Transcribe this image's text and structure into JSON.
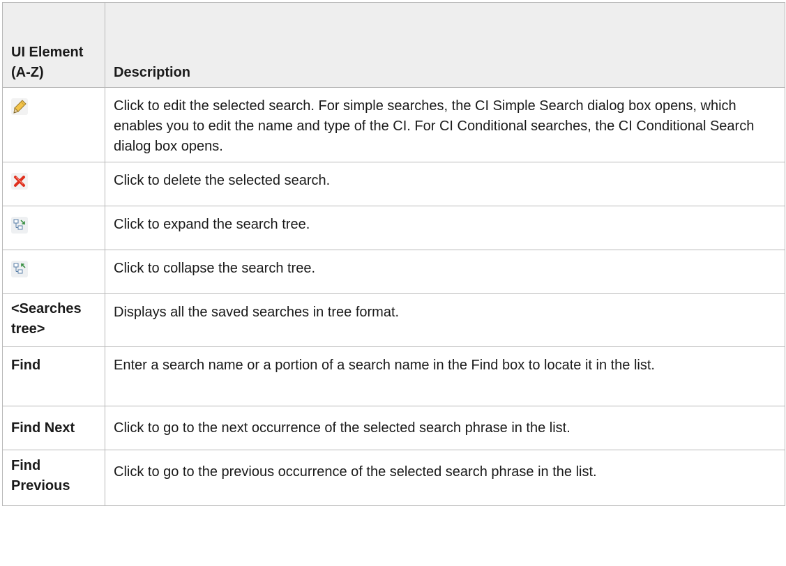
{
  "table": {
    "header": {
      "element": "UI Element (A-Z)",
      "description": "Description"
    },
    "rows": [
      {
        "icon": "edit-pencil-icon",
        "description": "Click to edit the selected search. For simple searches, the CI Simple Search dialog box opens, which enables you to edit the name and type of the CI. For CI Conditional searches, the CI Conditional Search dialog box opens."
      },
      {
        "icon": "delete-x-icon",
        "description": "Click to delete the selected search."
      },
      {
        "icon": "expand-tree-icon",
        "description": "Click to expand the search tree."
      },
      {
        "icon": "collapse-tree-icon",
        "description": "Click to collapse the search tree."
      },
      {
        "element": "<Searches tree>",
        "description": "Displays all the saved searches in tree format."
      },
      {
        "element": "Find",
        "description": "Enter a search name or a portion of a search name in the Find box to locate it in the list."
      },
      {
        "element": "Find Next",
        "description": "Click to go to the next occurrence of the selected search phrase in the list."
      },
      {
        "element": "Find Previous",
        "description": "Click to go to the previous occurrence of the selected search phrase in the list."
      }
    ]
  },
  "colors": {
    "header_bg": "#eeeeee",
    "border": "#b9b9b9",
    "delete_red": "#e0301e"
  }
}
